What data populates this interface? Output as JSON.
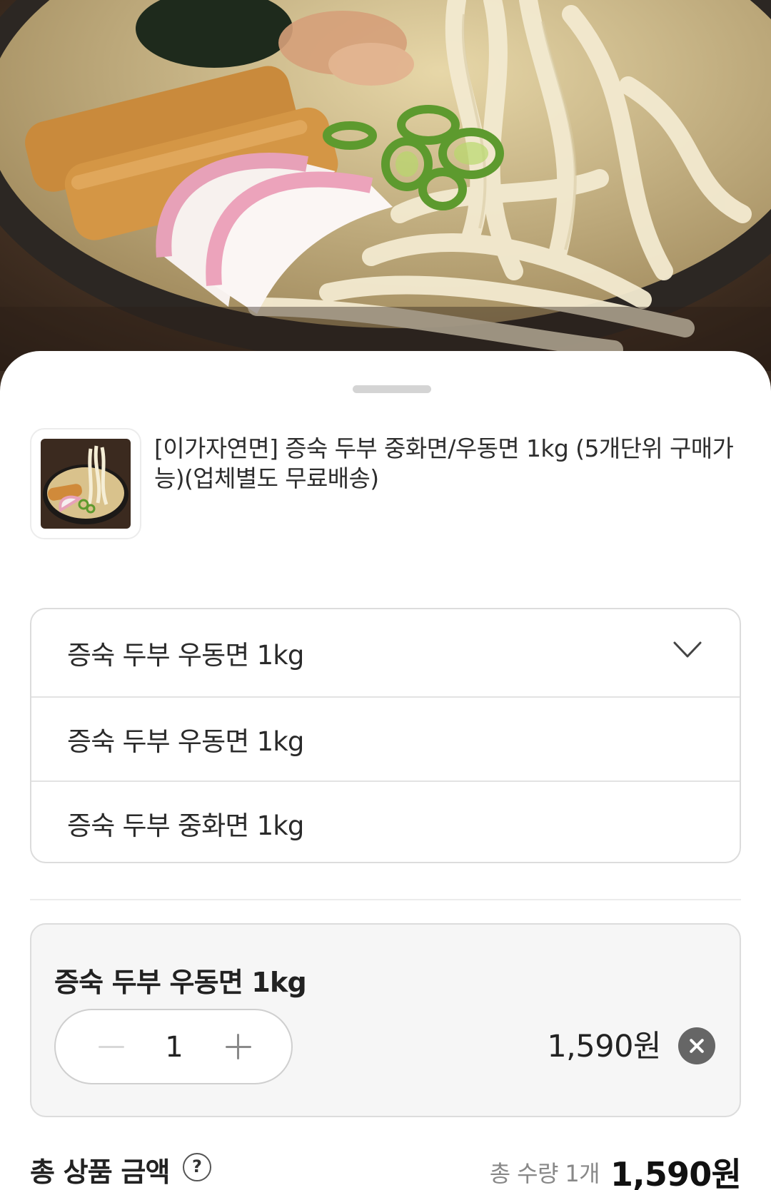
{
  "product": {
    "title": "[이가자연면] 증숙 두부 중화면/우동면 1kg (5개단위 구매가능)(업체별도 무료배송)"
  },
  "option_select": {
    "selected_value": "증숙 두부 우동면 1kg",
    "options": [
      {
        "label": "증숙 두부 우동면 1kg"
      },
      {
        "label": "증숙 두부 중화면 1kg"
      }
    ]
  },
  "selected_item": {
    "name": "증숙 두부 우동면 1kg",
    "quantity": "1",
    "price": "1,590원"
  },
  "summary": {
    "total_label": "총 상품 금액",
    "help_glyph": "?",
    "total_quantity": "총 수량 1개",
    "total_price": "1,590원"
  },
  "icons": {
    "dropdown": "chevron-down-icon",
    "remove": "close-circle-icon",
    "help": "question-circle-icon",
    "decrease": "minus-icon",
    "increase": "plus-icon"
  },
  "colors": {
    "sheet_background": "#ffffff",
    "card_background": "#f6f6f6",
    "border": "#dcdcdc",
    "text_primary": "#222222",
    "text_muted": "#888888",
    "remove_button": "#666666"
  }
}
